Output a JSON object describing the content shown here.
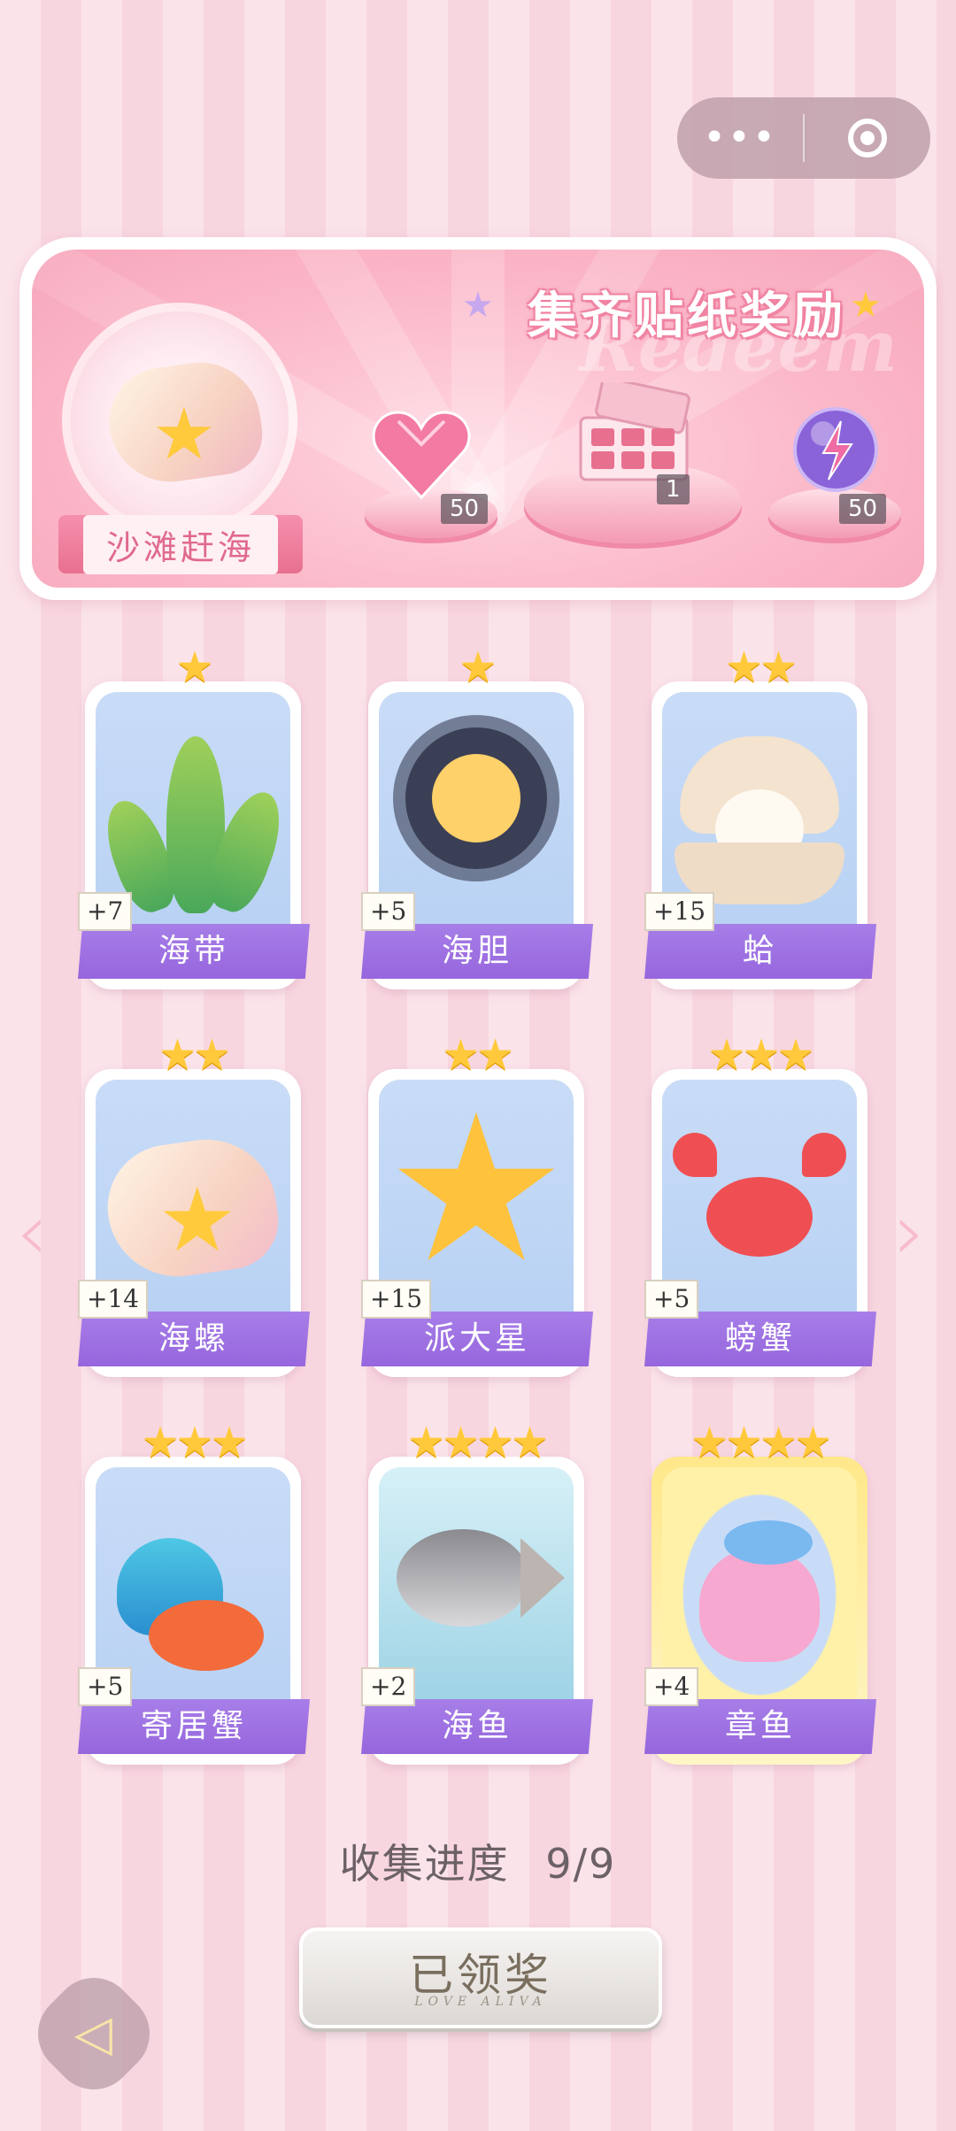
{
  "capsule": {
    "more_icon": "more-dots-icon",
    "target_icon": "target-icon",
    "more_text": "•••"
  },
  "banner": {
    "title": "集齐贴纸奖励",
    "watermark": "Redeem",
    "scene_label": "沙滩赶海",
    "rewards": [
      {
        "icon": "pink-heart-gem-icon",
        "count": "50"
      },
      {
        "icon": "gift-box-icon",
        "count": "1"
      },
      {
        "icon": "lightning-orb-icon",
        "count": "50"
      }
    ]
  },
  "cards": [
    {
      "name": "海带",
      "count": "+7",
      "stars": "★",
      "icon": "kelp-icon"
    },
    {
      "name": "海胆",
      "count": "+5",
      "stars": "★",
      "icon": "sea-urchin-icon"
    },
    {
      "name": "蛤",
      "count": "+15",
      "stars": "★★",
      "icon": "clam-icon"
    },
    {
      "name": "海螺",
      "count": "+14",
      "stars": "★★",
      "icon": "conch-icon"
    },
    {
      "name": "派大星",
      "count": "+15",
      "stars": "★★",
      "icon": "starfish-icon"
    },
    {
      "name": "螃蟹",
      "count": "+5",
      "stars": "★★★",
      "icon": "crab-icon"
    },
    {
      "name": "寄居蟹",
      "count": "+5",
      "stars": "★★★",
      "icon": "hermit-crab-icon"
    },
    {
      "name": "海鱼",
      "count": "+2",
      "stars": "★★★★",
      "icon": "fish-icon"
    },
    {
      "name": "章鱼",
      "count": "+4",
      "stars": "★★★★",
      "icon": "octopus-icon"
    }
  ],
  "progress": {
    "label": "收集进度",
    "value": "9/9"
  },
  "claim_button": {
    "label": "已领奖",
    "sub": "LOVE ALIVA"
  },
  "nav": {
    "prev_arrow": "‹",
    "next_arrow": "›"
  },
  "colors": {
    "accent_purple": "#9b6ee0",
    "banner_pink": "#f7a6bb",
    "star_gold": "#ffc93b"
  }
}
